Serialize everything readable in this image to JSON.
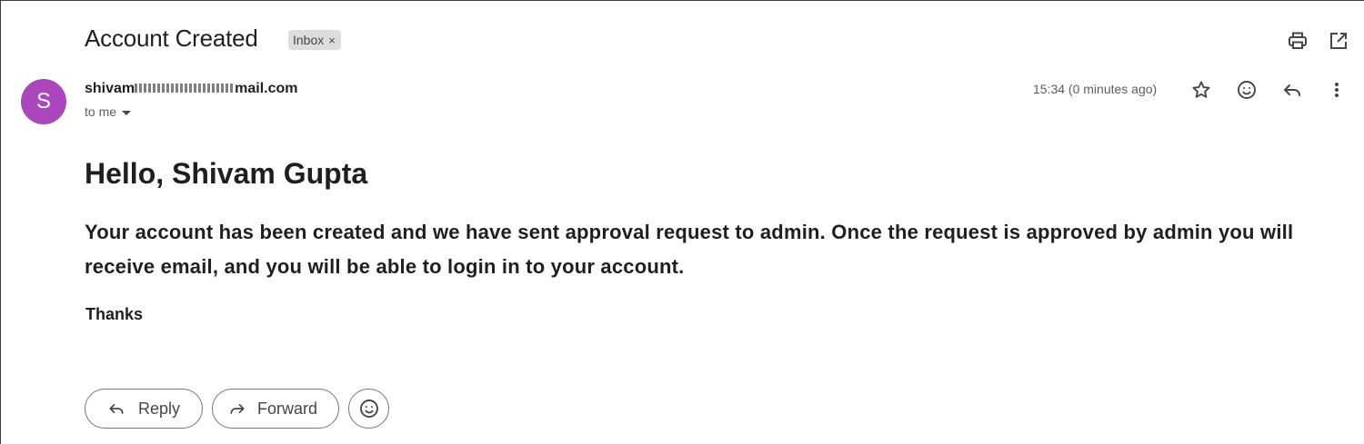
{
  "email": {
    "subject": "Account Created",
    "label": "Inbox",
    "label_remove": "×",
    "sender_prefix": "shivam",
    "sender_suffix": "mail.com",
    "avatar_letter": "S",
    "recipient": "to me",
    "timestamp": "15:34 (0 minutes ago)"
  },
  "body": {
    "greeting": "Hello, Shivam Gupta",
    "message": "Your account has been created and we have sent approval request to admin. Once the request is approved by admin you will receive email, and you will be able to login in to your account.",
    "signoff": "Thanks"
  },
  "actions": {
    "reply_label": "Reply",
    "forward_label": "Forward"
  },
  "icons": {
    "print": "print-icon",
    "open_new_window": "open-in-new-icon",
    "star": "star-icon",
    "emoji": "emoji-icon",
    "reply": "reply-icon",
    "more": "more-vert-icon"
  },
  "colors": {
    "avatar": "#ab47bc",
    "chip": "#dddddd"
  }
}
